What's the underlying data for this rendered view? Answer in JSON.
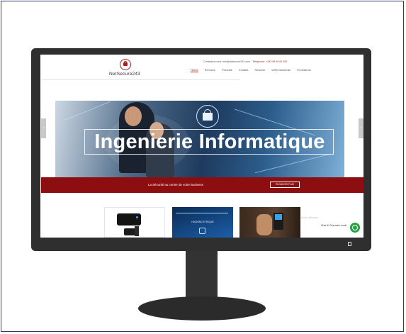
{
  "site": {
    "logo_text": "NetSecure243",
    "topbar": {
      "contact": "Contactez-nous: info@netsecure243.com",
      "phone": "Téléphone: +243 99 00 00 000"
    },
    "nav": [
      "Home",
      "Services",
      "Produits",
      "Contact",
      "Network",
      "Vêtements/trail",
      "Formations"
    ]
  },
  "hero": {
    "title": "Ingenierie Informatique",
    "prev_icon": "chevron-left-icon",
    "next_icon": "chevron-right-icon"
  },
  "banner": {
    "text": "La Sécurité au centre de votre Business",
    "button_label": "EN SAVOIR PLUS"
  },
  "cards": {
    "c2_label": "HACKING ETHIQUE",
    "c4_text": "Vidéo Wireless"
  },
  "chat": {
    "label": "Chat It! Chat avec nous!",
    "icon": "whatsapp-icon"
  },
  "colors": {
    "brand_red": "#8c0e10",
    "frame_border": "#2b3f66",
    "monitor": "#2f2f2f",
    "whatsapp": "#25a244"
  }
}
